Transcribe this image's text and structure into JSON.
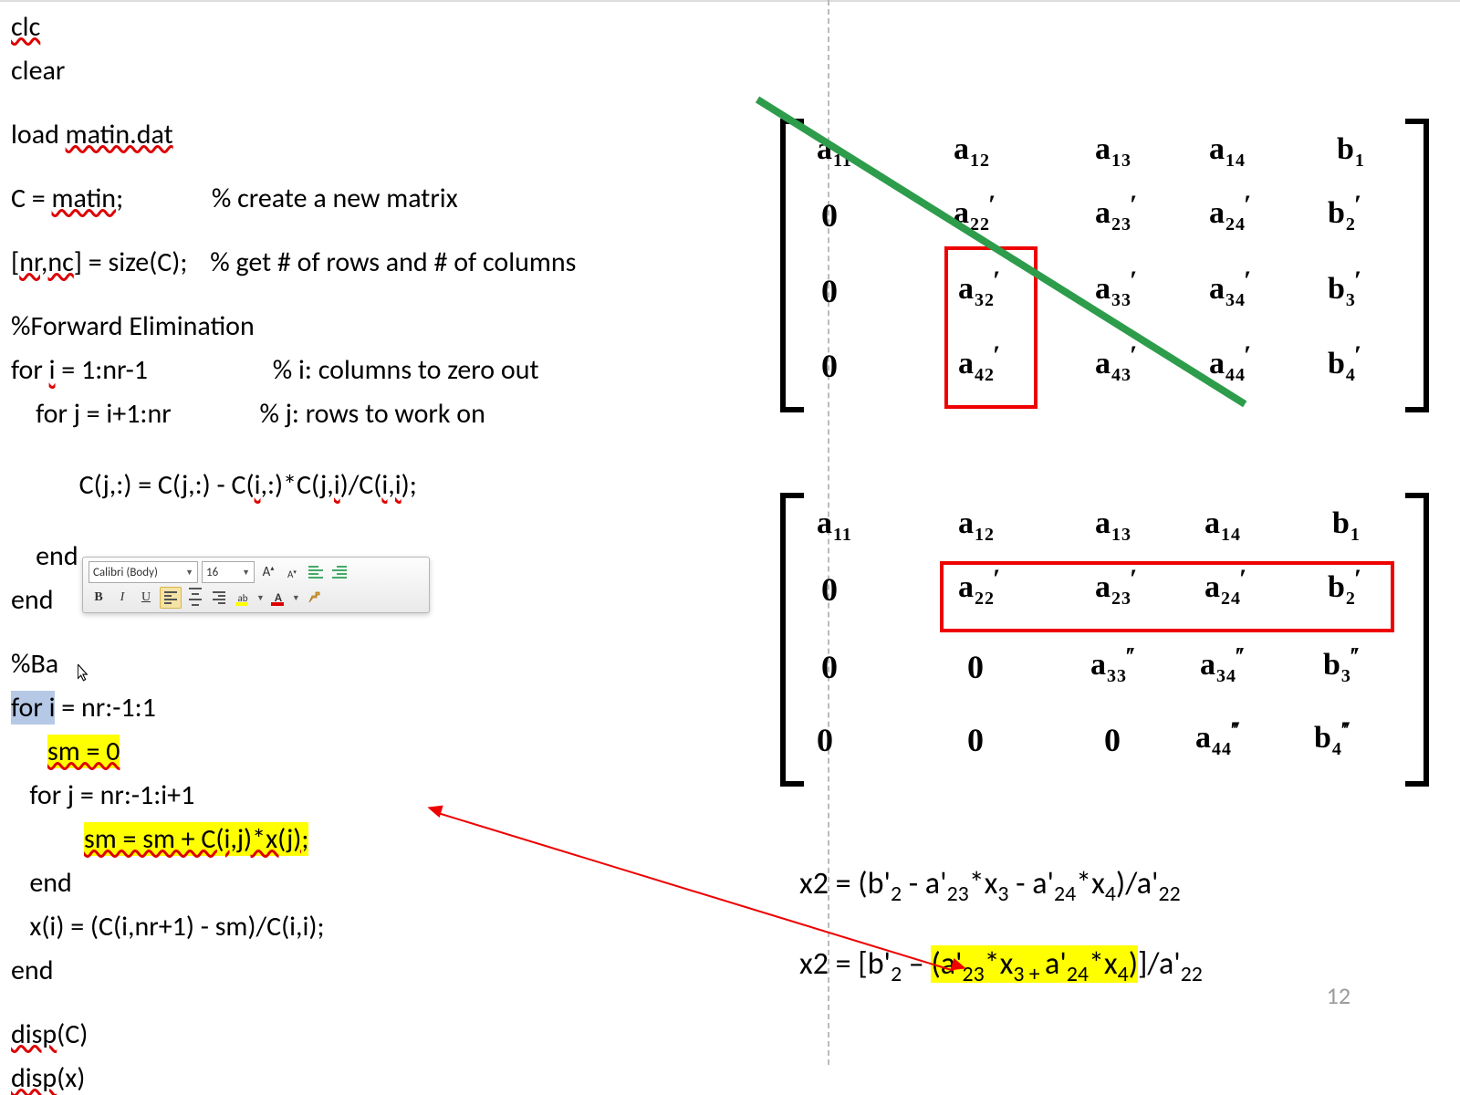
{
  "code": {
    "l1": "clc",
    "l2": "clear",
    "l3a": "load ",
    "l3b": "matin.dat",
    "l4a": "C = ",
    "l4b": "matin",
    "l4c": ";",
    "l4comment": "% create a new matrix",
    "l5a": "[",
    "l5b": "nr,nc",
    "l5c": "] = size(C);",
    "l5comment": "% get # of rows and # of columns",
    "l6": "%Forward Elimination",
    "l7a": " for ",
    "l7b": "i",
    "l7c": " = 1:nr-1",
    "l7comment": "% i: columns to zero out",
    "l8": "    for j = i+1:nr",
    "l8comment": "% j: rows to work on",
    "l9a": "       C(j,:) = C(j,:) - C(",
    "l9b": "i",
    "l9c": ",:)*C(",
    "l9d": "j,i",
    "l9e": ")/C(",
    "l9f": "i,i",
    "l9g": ");",
    "l10": "    end",
    "l11": "end",
    "l12": "%Ba",
    "l13a": "for i",
    "l13b": " = nr:-1:1",
    "l14": "sm = 0",
    "l15": "   for j = nr:-1:i+1",
    "l16": "sm = sm + C(i,j)*x(j);",
    "l17": "   end",
    "l18": "   x(i) = (C(i,nr+1) - sm)/C(i,i);",
    "l19": "end",
    "l20a": "disp",
    "l20b": "(C)",
    "l21a": "disp",
    "l21b": "(x)"
  },
  "toolbar": {
    "font": "Calibri (Body)",
    "size": "16"
  },
  "matrix1": {
    "rows": [
      [
        "a₁₁",
        "a₁₂",
        "a₁₃",
        "a₁₄",
        "b₁"
      ],
      [
        "0",
        "a'₂₂",
        "a'₂₃",
        "a'₂₄",
        "b'₂"
      ],
      [
        "0",
        "a'₃₂",
        "a'₃₃",
        "a'₃₄",
        "b'₃"
      ],
      [
        "0",
        "a'₄₂",
        "a'₄₃",
        "a'₄₄",
        "b'₄"
      ]
    ]
  },
  "matrix2": {
    "rows": [
      [
        "a₁₁",
        "a₁₂",
        "a₁₃",
        "a₁₄",
        "b₁"
      ],
      [
        "0",
        "a'₂₂",
        "a'₂₃",
        "a'₂₄",
        "b'₂"
      ],
      [
        "0",
        "0",
        "a''₃₃",
        "a''₃₄",
        "b''₃"
      ],
      [
        "0",
        "0",
        "0",
        "a'''₄₄",
        "b'''₄"
      ]
    ]
  },
  "eq1": {
    "lhs": "x2 = (b'",
    "s1": "2",
    "m1": " - a'",
    "s2": "23",
    "m2": "*x",
    "s3": "3",
    "m3": " - a'",
    "s4": "24",
    "m4": "*x",
    "s5": "4",
    "m5": ")/a'",
    "s6": "22"
  },
  "eq2": {
    "lhs": "x2 = [b'",
    "s1": "2",
    "m1": " – ",
    "hl_a": "(a'",
    "hs1": "23",
    "hm1": "*x",
    "hs2": "3 + ",
    "hm2": "a'",
    "hs3": "24",
    "hm3": "*x",
    "hs4": "4",
    "hl_b": ")",
    "m2": "]/a'",
    "s2": "22"
  },
  "page": "12"
}
